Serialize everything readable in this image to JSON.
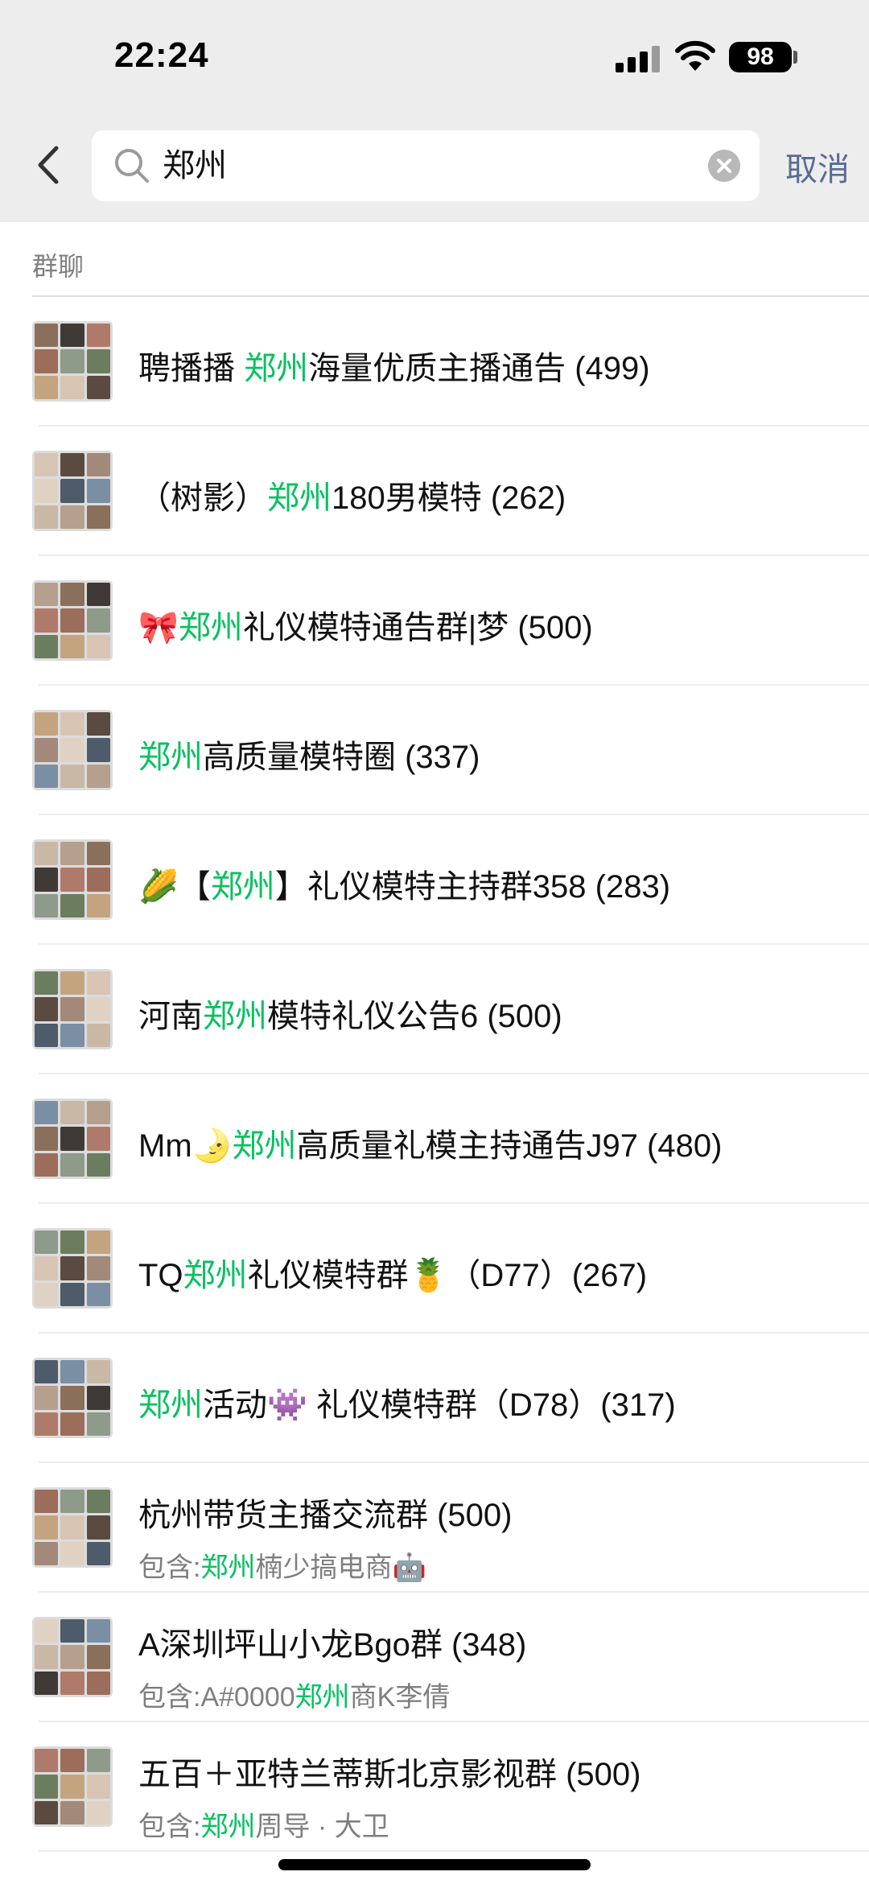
{
  "status_bar": {
    "time": "22:24",
    "battery": "98"
  },
  "search": {
    "query": "郑州",
    "cancel_label": "取消"
  },
  "section": {
    "header": "群聊"
  },
  "groups": [
    {
      "pre": "聘播播 ",
      "kw": "郑州",
      "post": "海量优质主播通告 (499)",
      "sub_pre": "",
      "sub_kw": "",
      "sub_post": ""
    },
    {
      "pre": "（树影）",
      "kw": "郑州",
      "post": "180男模特 (262)",
      "sub_pre": "",
      "sub_kw": "",
      "sub_post": ""
    },
    {
      "pre": "🎀",
      "kw": "郑州",
      "post": "礼仪模特通告群|梦 (500)",
      "sub_pre": "",
      "sub_kw": "",
      "sub_post": ""
    },
    {
      "pre": "",
      "kw": "郑州",
      "post": "高质量模特圈 (337)",
      "sub_pre": "",
      "sub_kw": "",
      "sub_post": ""
    },
    {
      "pre": "🌽【",
      "kw": "郑州",
      "post": "】礼仪模特主持群358 (283)",
      "sub_pre": "",
      "sub_kw": "",
      "sub_post": ""
    },
    {
      "pre": "河南",
      "kw": "郑州",
      "post": "模特礼仪公告6 (500)",
      "sub_pre": "",
      "sub_kw": "",
      "sub_post": ""
    },
    {
      "pre": "Mm🌛",
      "kw": "郑州",
      "post": "高质量礼模主持通告J97 (480)",
      "sub_pre": "",
      "sub_kw": "",
      "sub_post": ""
    },
    {
      "pre": "TQ",
      "kw": "郑州",
      "post": "礼仪模特群🍍（D77）(267)",
      "sub_pre": "",
      "sub_kw": "",
      "sub_post": ""
    },
    {
      "pre": "",
      "kw": "郑州",
      "post": "活动👾 礼仪模特群（D78）(317)",
      "sub_pre": "",
      "sub_kw": "",
      "sub_post": ""
    },
    {
      "pre": "杭州带货主播交流群 (500)",
      "kw": "",
      "post": "",
      "sub_pre": "包含:",
      "sub_kw": "郑州",
      "sub_post": "楠少搞电商🤖"
    },
    {
      "pre": "A深圳坪山小龙Bgo群 (348)",
      "kw": "",
      "post": "",
      "sub_pre": "包含:A#0000",
      "sub_kw": "郑州",
      "sub_post": "商K李倩"
    },
    {
      "pre": "五百＋亚特兰蒂斯北京影视群 (500)",
      "kw": "",
      "post": "",
      "sub_pre": "包含:",
      "sub_kw": "郑州",
      "sub_post": "周导 · 大卫"
    }
  ],
  "colors": {
    "highlight": "#07c160",
    "link": "#576b95",
    "header_bg": "#ededed"
  },
  "icons": [
    "back-arrow-icon",
    "search-icon",
    "clear-icon",
    "signal-icon",
    "wifi-icon",
    "battery-icon"
  ]
}
